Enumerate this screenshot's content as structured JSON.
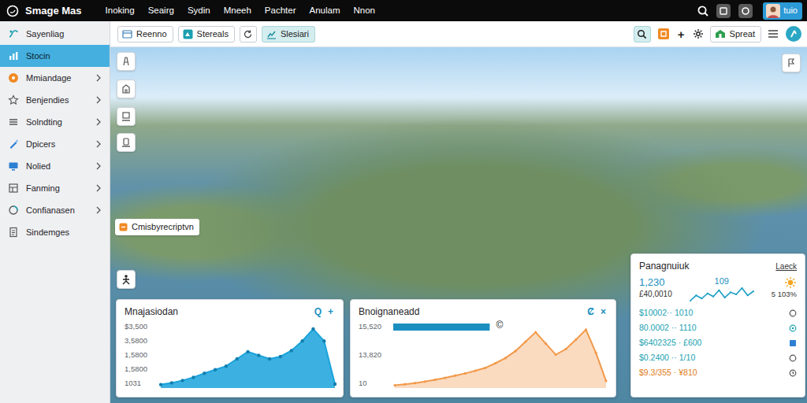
{
  "app": {
    "logo": "Smage Mas",
    "menu": [
      "Inoking",
      "Seairg",
      "Sydin",
      "Mneeh",
      "Pachter",
      "Anulam",
      "Nnon"
    ],
    "avatar": "tuio"
  },
  "sidebar": {
    "items": [
      {
        "label": "Sayenliag",
        "selected": false,
        "expandable": false
      },
      {
        "label": "Stocin",
        "selected": true,
        "expandable": false
      },
      {
        "label": "Mmiandage",
        "selected": false,
        "expandable": true
      },
      {
        "label": "Benjendies",
        "selected": false,
        "expandable": true
      },
      {
        "label": "Solndting",
        "selected": false,
        "expandable": true
      },
      {
        "label": "Dpicers",
        "selected": false,
        "expandable": true
      },
      {
        "label": "Nolied",
        "selected": false,
        "expandable": true
      },
      {
        "label": "Fanming",
        "selected": false,
        "expandable": true
      },
      {
        "label": "Confianasen",
        "selected": false,
        "expandable": true
      },
      {
        "label": "Sindemges",
        "selected": false,
        "expandable": false
      }
    ]
  },
  "toolbar": {
    "items": [
      {
        "kind": "button",
        "label": "Reenno",
        "selected": false
      },
      {
        "kind": "button",
        "label": "Stereals",
        "selected": false
      },
      {
        "kind": "icon",
        "selected": false
      },
      {
        "kind": "button",
        "label": "Slesiari",
        "selected": true
      }
    ],
    "search_selected": true,
    "plus": "+",
    "action": "Spreat"
  },
  "map": {
    "label": "Cmisbyrecriptvn"
  },
  "charts": [
    {
      "title": "Mnajasiodan",
      "actions": [
        "Q",
        "+"
      ],
      "ticks": [
        "$3,500",
        "3,5800",
        "1,5800",
        "1,5800",
        "1031"
      ],
      "axis": {
        "min": 1000,
        "max": 3500
      },
      "series": [
        {
          "values": [
            1080,
            1150,
            1250,
            1380,
            1550,
            1700,
            1850,
            2150,
            2450,
            2300,
            2150,
            2250,
            2500,
            2900,
            3400,
            2900,
            1100
          ],
          "color": "#1aa3dc"
        }
      ]
    },
    {
      "title": "Bnoignaneadd",
      "actions": [
        "Ȼ",
        "×"
      ],
      "ticks": [
        "15,520",
        "13,820",
        "10"
      ],
      "axis": {
        "min": 0,
        "max": 16000
      },
      "bar": {
        "level": 0.45
      },
      "marker": "©",
      "series": [
        {
          "values": [
            300,
            600,
            900,
            1300,
            1800,
            2300,
            2900,
            3500,
            4200,
            5000,
            6200,
            7600,
            9500,
            12000,
            14500,
            11500,
            8500,
            10000,
            12500,
            15200,
            9000,
            1500
          ],
          "color": "#f2994a"
        }
      ]
    }
  ],
  "stats": {
    "title": "Panagnuiuk",
    "link": "Laeck",
    "value": "1,230",
    "count": "109",
    "change": "5 103%",
    "total": "£40,0010",
    "sparkline": [
      20,
      45,
      30,
      55,
      40,
      70,
      35,
      60,
      50,
      80,
      45,
      65
    ],
    "rows": [
      {
        "text": "$10002·· 1010",
        "color": "#1b9fb0"
      },
      {
        "text": "80.0002 ·· 1110",
        "color": "#1b9fb0"
      },
      {
        "text": "$6402325 · £600",
        "color": "#1b9fb0"
      },
      {
        "text": "$0.2400 ·· 1/10",
        "color": "#1b9fb0"
      },
      {
        "text": "$9.3/355 · ¥810",
        "color": "#e07b20"
      }
    ]
  }
}
